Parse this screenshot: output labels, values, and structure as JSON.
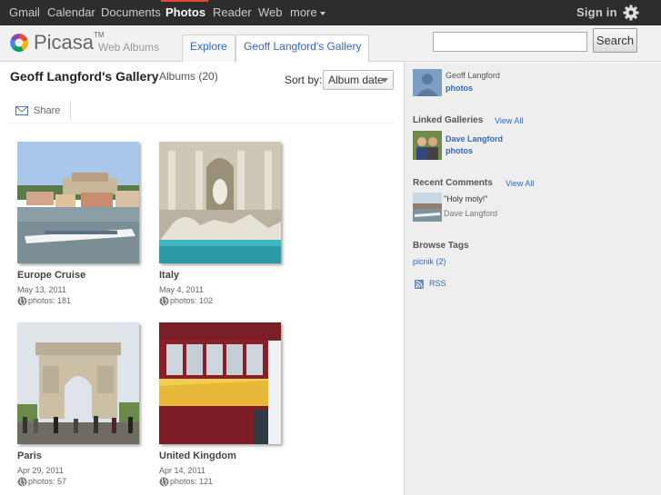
{
  "gbar": {
    "links": [
      "Gmail",
      "Calendar",
      "Documents",
      "Photos",
      "Reader",
      "Web",
      "more"
    ],
    "signin": "Sign in"
  },
  "header": {
    "brand": "Picasa",
    "tm": "TM",
    "subbrand": "Web Albums",
    "tabs": [
      "Explore",
      "Geoff Langford's Gallery"
    ],
    "search_value": "",
    "search_button": "Search"
  },
  "main": {
    "title": "Geoff Langford's Gallery",
    "albums_count": "Albums (20)",
    "sort_label": "Sort by:",
    "sort_value": "Album date",
    "share_label": "Share",
    "albums": [
      {
        "title": "Europe Cruise",
        "date": "May 13, 2011",
        "count": "photos: 181"
      },
      {
        "title": "Italy",
        "date": "May 4, 2011",
        "count": "photos: 102"
      },
      {
        "title": "Paris",
        "date": "Apr 29, 2011",
        "count": "photos: 57"
      },
      {
        "title": "United Kingdom",
        "date": "Apr 14, 2011",
        "count": "photos: 121"
      }
    ]
  },
  "sidebar": {
    "owner_name": "Geoff Langford",
    "owner_photos": "photos",
    "linked_heading": "Linked Galleries",
    "linked_viewall": "View All",
    "linked_name": "Dave Langford",
    "linked_photos": "photos",
    "comments_heading": "Recent Comments",
    "comments_viewall": "View All",
    "comment_text": "\"Holy moly!\"",
    "comment_author": "Dave Langford",
    "tags_heading": "Browse Tags",
    "tag": "picnik (2)",
    "rss": "RSS"
  },
  "colors": {
    "gbar_bg": "#2d2d2d",
    "active_red": "#dd4b39",
    "link_blue": "#3366cc",
    "sidebar_bg": "#eeeeee"
  },
  "icons": [
    "picasa-logo-icon",
    "gear-icon",
    "envelope-icon",
    "globe-icon",
    "rss-icon"
  ]
}
